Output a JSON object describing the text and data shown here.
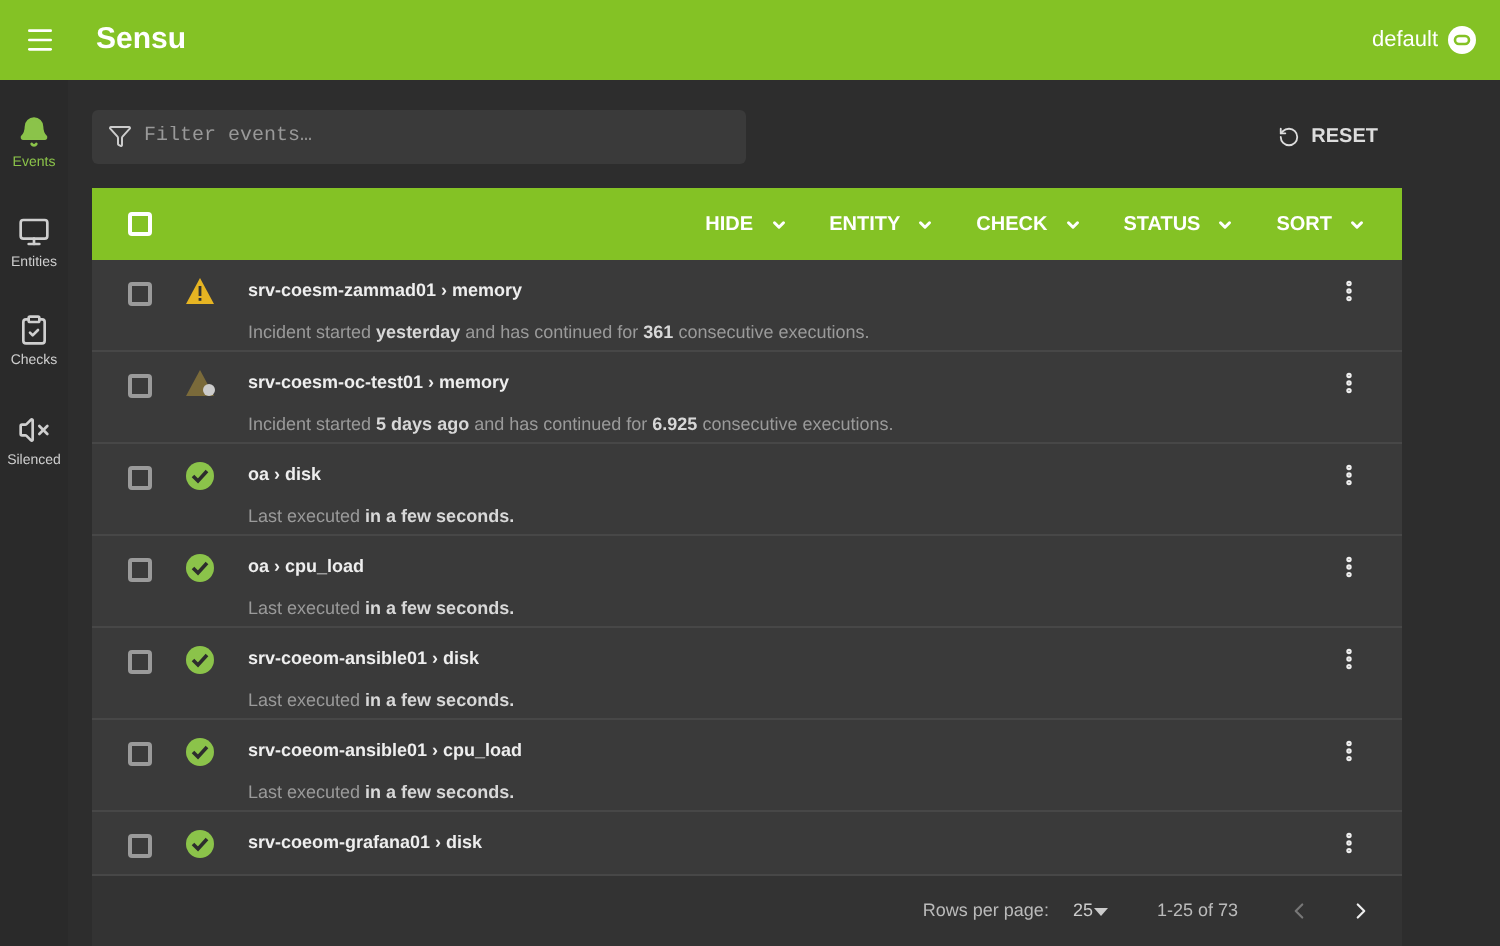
{
  "app_bar": {
    "title": "Sensu",
    "namespace": "default"
  },
  "sidebar": {
    "items": [
      {
        "label": "Events",
        "kind": "bell",
        "selected": true
      },
      {
        "label": "Entities",
        "kind": "monitor",
        "selected": false
      },
      {
        "label": "Checks",
        "kind": "clipboard",
        "selected": false
      },
      {
        "label": "Silenced",
        "kind": "muted",
        "selected": false
      }
    ]
  },
  "filter": {
    "placeholder": "Filter events…"
  },
  "reset_button": "RESET",
  "table": {
    "select_all_checked": false,
    "columns": [
      "HIDE",
      "ENTITY",
      "CHECK",
      "STATUS",
      "SORT"
    ],
    "rows": [
      {
        "kind": "warning",
        "checked": false,
        "title": "srv-coesm-zammad01 › memory",
        "detail": "Incident started **yesterday** and has continued for **361** consecutive executions."
      },
      {
        "kind": "warning-silenced",
        "checked": false,
        "title": "srv-coesm-oc-test01 › memory",
        "detail": "Incident started **5 days ago** and has continued for **6.925** consecutive executions."
      },
      {
        "kind": "ok",
        "checked": false,
        "title": "oa › disk",
        "detail": "Last executed **in a few seconds.**"
      },
      {
        "kind": "ok",
        "checked": false,
        "title": "oa › cpu_load",
        "detail": "Last executed **in a few seconds.**"
      },
      {
        "kind": "ok",
        "checked": false,
        "title": "srv-coeom-ansible01 › disk",
        "detail": "Last executed **in a few seconds.**"
      },
      {
        "kind": "ok",
        "checked": false,
        "title": "srv-coeom-ansible01 › cpu_load",
        "detail": "Last executed **in a few seconds.**"
      },
      {
        "kind": "ok",
        "checked": false,
        "title": "srv-coeom-grafana01 › disk"
      }
    ]
  },
  "pagination": {
    "rows_per_page_label": "Rows per page:",
    "rows_per_page": "25",
    "range": "1-25 of 73"
  }
}
